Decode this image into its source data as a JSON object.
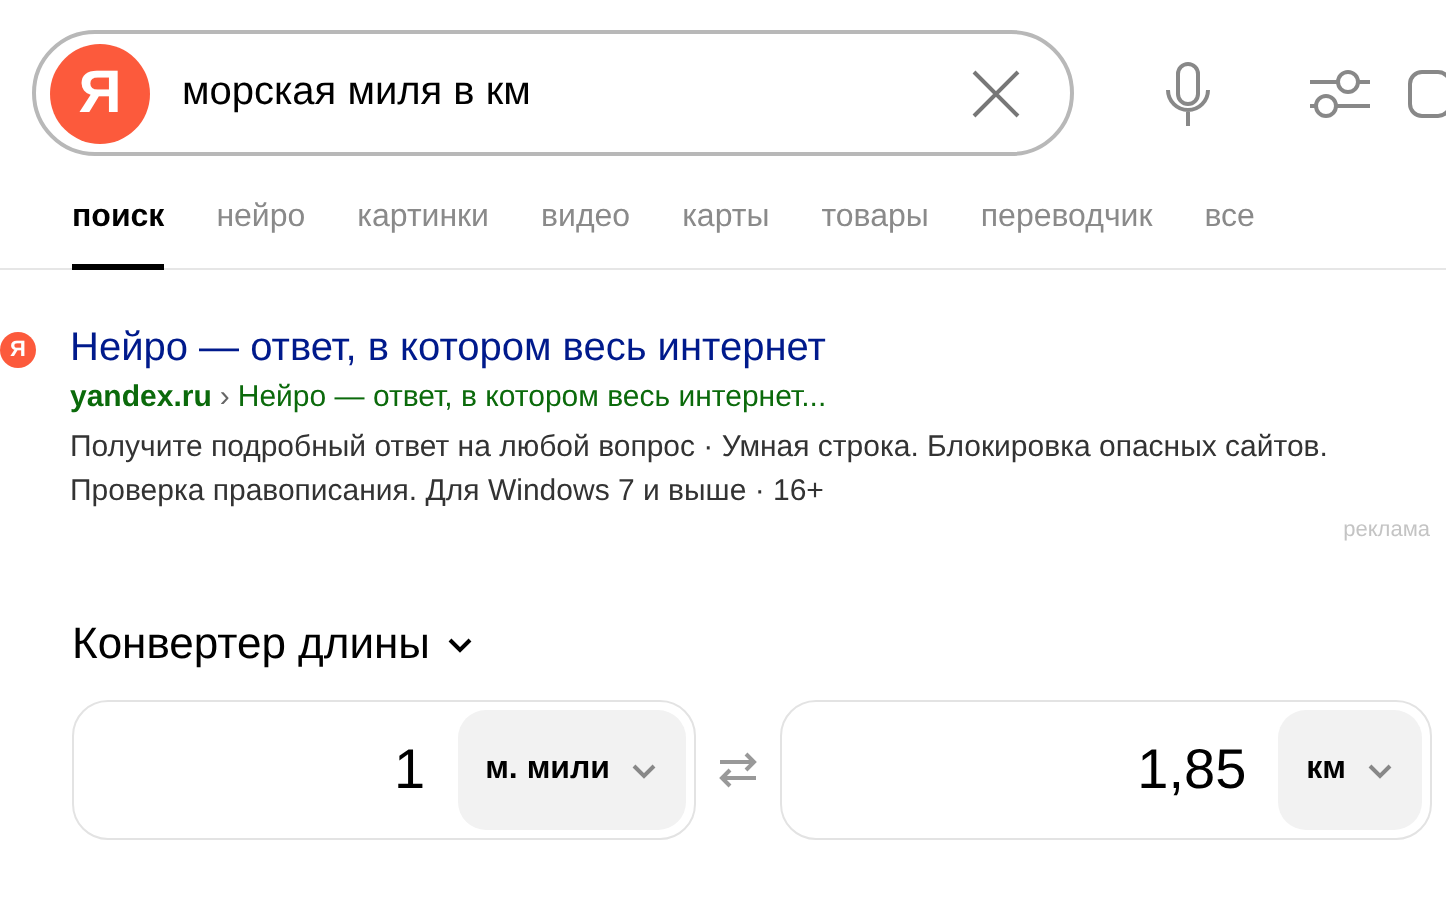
{
  "search": {
    "logo": "Я",
    "query": "морская миля в км"
  },
  "tabs": [
    {
      "label": "поиск",
      "selected": true
    },
    {
      "label": "нейро",
      "selected": false
    },
    {
      "label": "картинки",
      "selected": false
    },
    {
      "label": "видео",
      "selected": false
    },
    {
      "label": "карты",
      "selected": false
    },
    {
      "label": "товары",
      "selected": false
    },
    {
      "label": "переводчик",
      "selected": false
    },
    {
      "label": "все",
      "selected": false
    }
  ],
  "ad": {
    "logo": "Я",
    "title": "Нейро — ответ, в котором весь интернет",
    "domain": "yandex.ru",
    "separator": "›",
    "path": "Нейро — ответ, в котором весь интернет...",
    "description": "Получите подробный ответ на любой вопрос · Умная строка. Блокировка опасных сайтов. Проверка правописания. Для Windows 7 и выше · 16+",
    "label": "реклама"
  },
  "converter": {
    "title": "Конвертер длины",
    "from": {
      "value": "1",
      "unit": "м. мили"
    },
    "to": {
      "value": "1,85",
      "unit": "км"
    }
  }
}
